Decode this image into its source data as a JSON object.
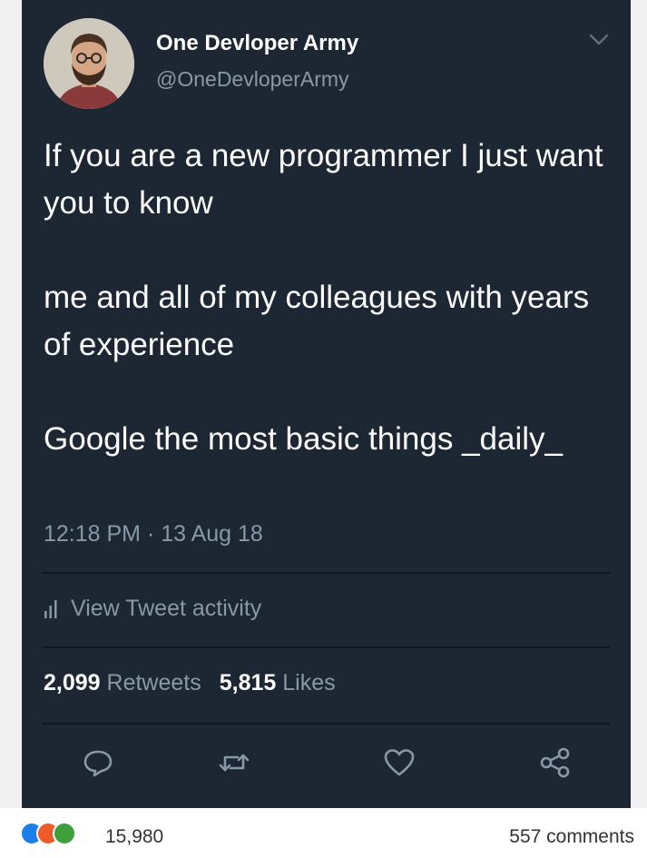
{
  "tweet": {
    "author_name": "One Devloper Army",
    "author_handle": "@OneDevloperArmy",
    "paragraphs": [
      "If you are a new programmer I just want you to know",
      "me and all of my colleagues with years of experience",
      "Google the most basic things _daily_"
    ],
    "timestamp": "12:18 PM · 13 Aug 18",
    "activity_label": "View Tweet activity",
    "retweets_count": "2,099",
    "retweets_label": "Retweets",
    "likes_count": "5,815",
    "likes_label": "Likes"
  },
  "footer": {
    "reaction_count": "15,980",
    "comments": "557 comments"
  },
  "icons": {
    "menu": "chevron-down-icon",
    "activity": "bar-chart-icon",
    "reply": "reply-icon",
    "retweet": "retweet-icon",
    "like": "heart-icon",
    "share": "share-icon"
  },
  "colors": {
    "card_background": "#1c2733",
    "secondary_text": "#8899a6",
    "primary_text": "#ffffff",
    "reaction_blue": "#1a7fe8",
    "reaction_orange": "#ef5a29",
    "reaction_green": "#3f9f3a"
  }
}
